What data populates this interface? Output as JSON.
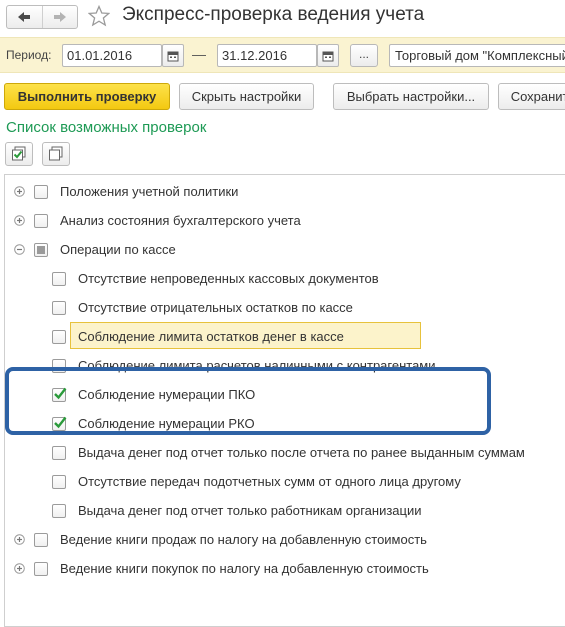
{
  "window": {
    "title": "Экспресс-проверка ведения учета",
    "nav_icons": [
      "arrow-left-icon",
      "arrow-right-icon"
    ],
    "favorite_icon": "star-icon"
  },
  "period": {
    "label": "Период:",
    "date_from": "01.01.2016",
    "date_to": "31.12.2016",
    "separator": "—",
    "choose_label": "...",
    "organization": "Торговый дом \"Комплексный\""
  },
  "toolbar": {
    "run_label": "Выполнить проверку",
    "hide_settings_label": "Скрыть настройки",
    "choose_settings_label": "Выбрать настройки...",
    "save_label": "Сохранить"
  },
  "checks_section": {
    "title": "Список возможных проверок",
    "check_all_icon": "check-all-icon",
    "uncheck_all_icon": "uncheck-all-icon"
  },
  "tree": {
    "items": [
      {
        "label": "Положения учетной политики",
        "level": 0,
        "expander": "collapsed",
        "state": "unchecked"
      },
      {
        "label": "Анализ состояния бухгалтерского учета",
        "level": 0,
        "expander": "collapsed",
        "state": "unchecked"
      },
      {
        "label": "Операции по кассе",
        "level": 0,
        "expander": "expanded",
        "state": "partial"
      },
      {
        "label": "Отсутствие непроведенных кассовых документов",
        "level": 1,
        "state": "unchecked"
      },
      {
        "label": "Отсутствие отрицательных остатков по кассе",
        "level": 1,
        "state": "unchecked"
      },
      {
        "label": "Соблюдение лимита остатков денег в кассе",
        "level": 1,
        "state": "unchecked"
      },
      {
        "label": "Соблюдение лимита расчетов наличными с контрагентами",
        "level": 1,
        "state": "unchecked"
      },
      {
        "label": "Соблюдение нумерации ПКО",
        "level": 1,
        "state": "checked"
      },
      {
        "label": "Соблюдение нумерации РКО",
        "level": 1,
        "state": "checked"
      },
      {
        "label": "Выдача денег под отчет только после отчета по ранее выданным суммам",
        "level": 1,
        "state": "unchecked"
      },
      {
        "label": "Отсутствие передач подотчетных сумм от одного лица другому",
        "level": 1,
        "state": "unchecked"
      },
      {
        "label": "Выдача денег под отчет только работникам организации",
        "level": 1,
        "state": "unchecked",
        "selected": true
      },
      {
        "label": "Ведение книги продаж по налогу на добавленную стоимость",
        "level": 0,
        "expander": "collapsed",
        "state": "unchecked"
      },
      {
        "label": "Ведение книги покупок по налогу на добавленную стоимость",
        "level": 0,
        "expander": "collapsed",
        "state": "unchecked"
      }
    ]
  },
  "colors": {
    "accent_green": "#1e9a55",
    "primary_button": "#f5cf1e",
    "period_bar": "#faf3d1",
    "selection": "#fcf3cb",
    "callout_border": "#2e62a5",
    "check_mark": "#2a9a3a"
  }
}
